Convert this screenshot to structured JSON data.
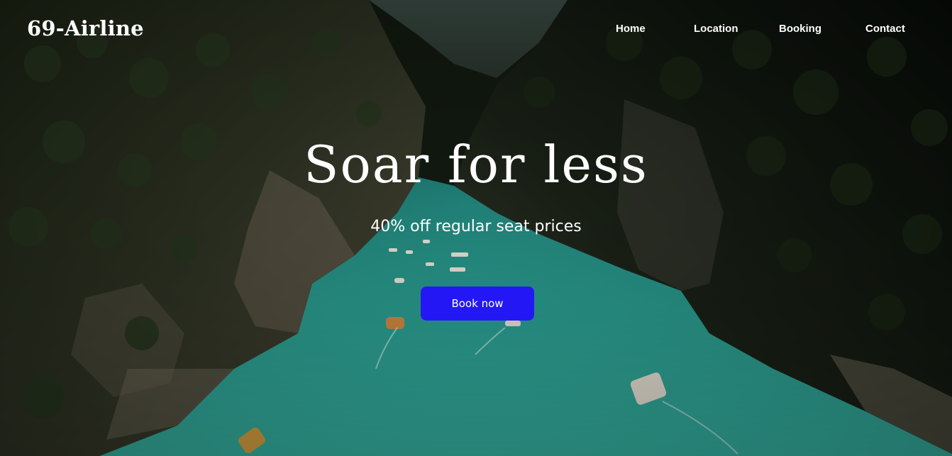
{
  "brand": {
    "logo_text": "69-Airline"
  },
  "nav": {
    "items": [
      {
        "label": "Home"
      },
      {
        "label": "Location"
      },
      {
        "label": "Booking"
      },
      {
        "label": "Contact"
      }
    ]
  },
  "hero": {
    "headline": "Soar for less",
    "subheadline": "40% off regular seat prices",
    "cta_label": "Book now",
    "background_image": "river-canyon-aerial-photo",
    "colors": {
      "cta": "#2318f5",
      "text": "#ffffff",
      "water": "#2fa89a"
    }
  }
}
